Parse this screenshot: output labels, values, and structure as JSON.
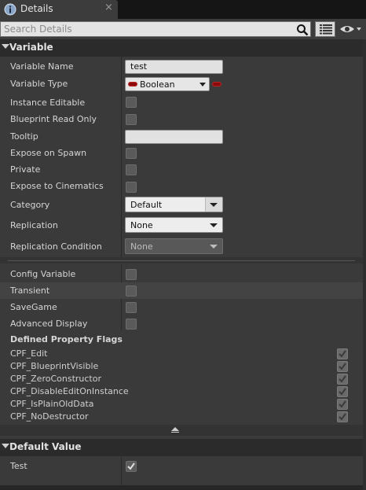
{
  "tab": {
    "title": "Details",
    "close_glyph": "×",
    "icon": "details-info-icon"
  },
  "search": {
    "placeholder": "Search Details",
    "value": "",
    "icons": [
      "search-icon",
      "property-matrix-icon",
      "view-options-eye-icon"
    ]
  },
  "colors": {
    "accent_boolean_pin": "#8b0b0b",
    "panel_bg": "#3a3a3a",
    "header_bg": "#2b2b2b",
    "tab_bg": "#3c3c3c"
  },
  "variable_section": {
    "title": "Variable",
    "rows": {
      "variable_name": {
        "label": "Variable Name",
        "value": "test"
      },
      "variable_type": {
        "label": "Variable Type",
        "value": "Boolean"
      },
      "instance_editable": {
        "label": "Instance Editable",
        "checked": false
      },
      "blueprint_read_only": {
        "label": "Blueprint Read Only",
        "checked": false
      },
      "tooltip": {
        "label": "Tooltip",
        "value": ""
      },
      "expose_on_spawn": {
        "label": "Expose on Spawn",
        "checked": false
      },
      "private": {
        "label": "Private",
        "checked": false
      },
      "expose_to_cinematics": {
        "label": "Expose to Cinematics",
        "checked": false
      },
      "category": {
        "label": "Category",
        "value": "Default"
      },
      "replication": {
        "label": "Replication",
        "value": "None"
      },
      "replication_condition": {
        "label": "Replication Condition",
        "value": "None"
      }
    },
    "advanced": {
      "config_variable": {
        "label": "Config Variable",
        "checked": false
      },
      "transient": {
        "label": "Transient",
        "checked": false
      },
      "save_game": {
        "label": "SaveGame",
        "checked": false
      },
      "advanced_display": {
        "label": "Advanced Display",
        "checked": false
      },
      "defined_flags_title": "Defined Property Flags",
      "flags": [
        {
          "label": "CPF_Edit",
          "checked": true
        },
        {
          "label": "CPF_BlueprintVisible",
          "checked": true
        },
        {
          "label": "CPF_ZeroConstructor",
          "checked": true
        },
        {
          "label": "CPF_DisableEditOnInstance",
          "checked": true
        },
        {
          "label": "CPF_IsPlainOldData",
          "checked": true
        },
        {
          "label": "CPF_NoDestructor",
          "checked": true
        }
      ]
    }
  },
  "default_value_section": {
    "title": "Default Value",
    "test": {
      "label": "Test",
      "checked": true
    }
  }
}
